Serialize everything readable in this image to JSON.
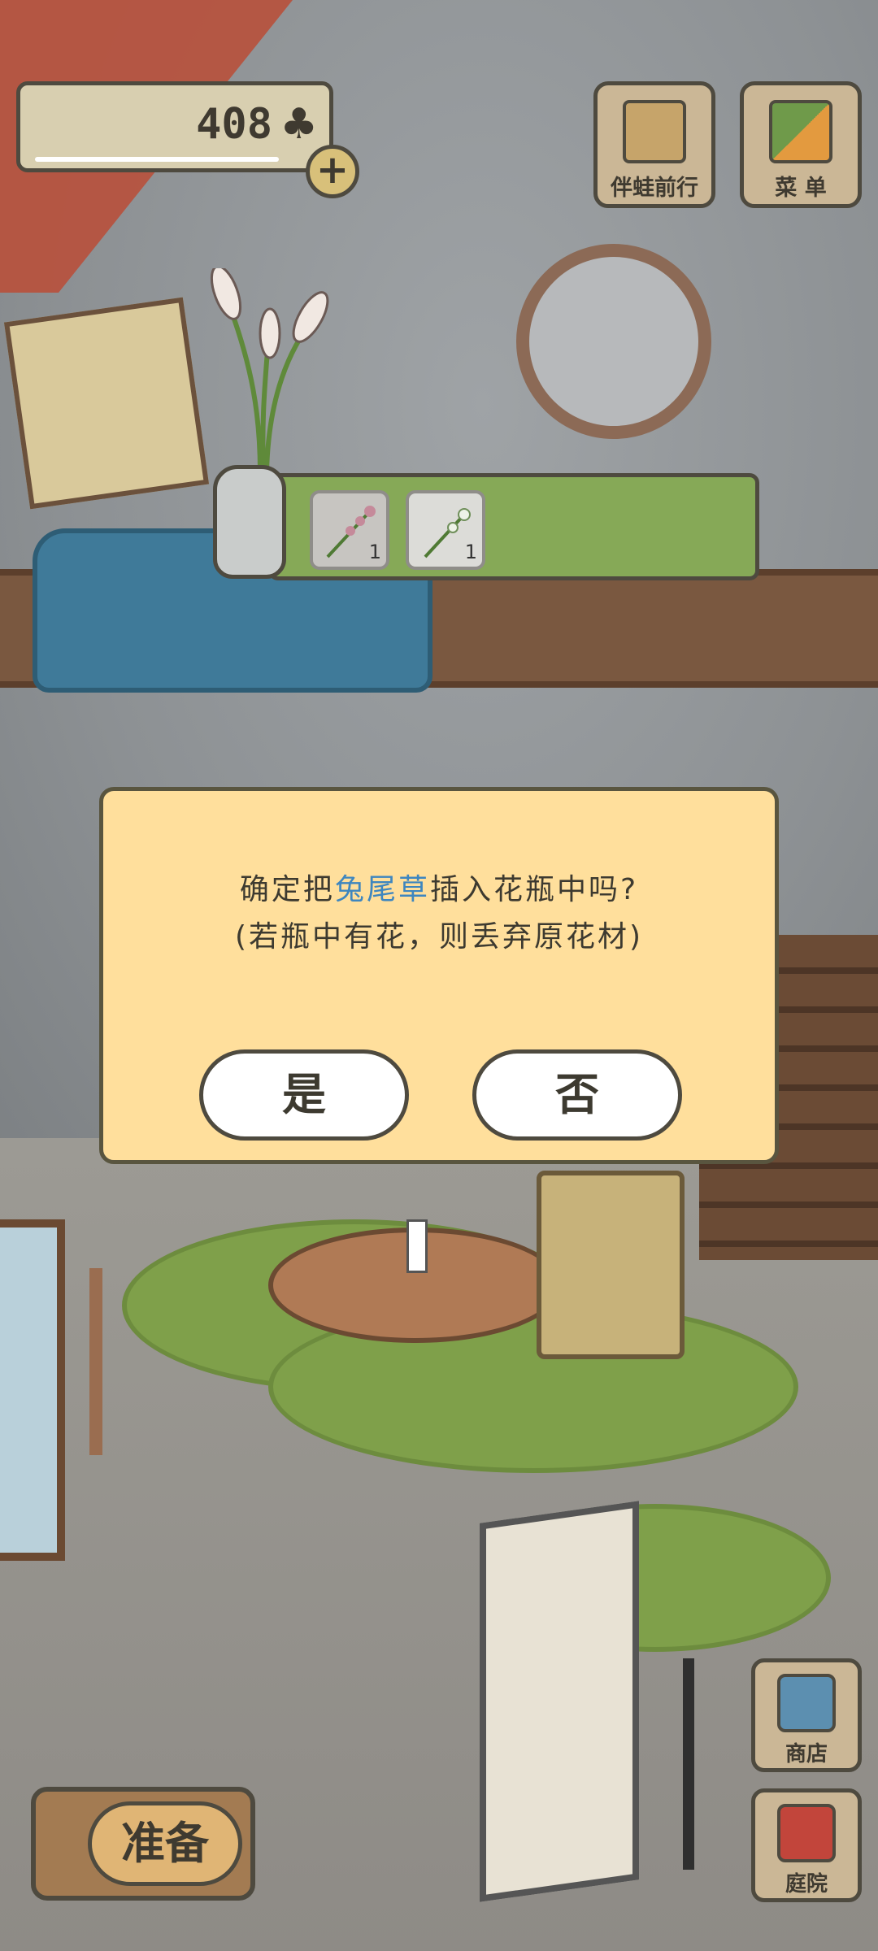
{
  "hud": {
    "clover_count": "408",
    "clover_icon": "clover-icon",
    "add_label": "+",
    "top_buttons": [
      {
        "label": "伴蛙前行",
        "icon": "travel-card-icon"
      },
      {
        "label": "菜 单",
        "icon": "menu-cards-icon"
      }
    ],
    "bottom_buttons": [
      {
        "label": "商店",
        "icon": "shop-bags-icon"
      },
      {
        "label": "庭院",
        "icon": "mailbox-icon"
      }
    ],
    "prepare_label": "准备"
  },
  "vase_bar": {
    "slots": [
      {
        "name": "pink-flower-sprig",
        "count": "1"
      },
      {
        "name": "white-flower-sprig",
        "count": "1"
      }
    ]
  },
  "dialog": {
    "line1_prefix": "确定把",
    "line1_highlight": "兔尾草",
    "line1_suffix": "插入花瓶中吗?",
    "line2": "(若瓶中有花，则丢弃原花材)",
    "yes_label": "是",
    "no_label": "否",
    "highlight_color": "#3e86bf"
  }
}
